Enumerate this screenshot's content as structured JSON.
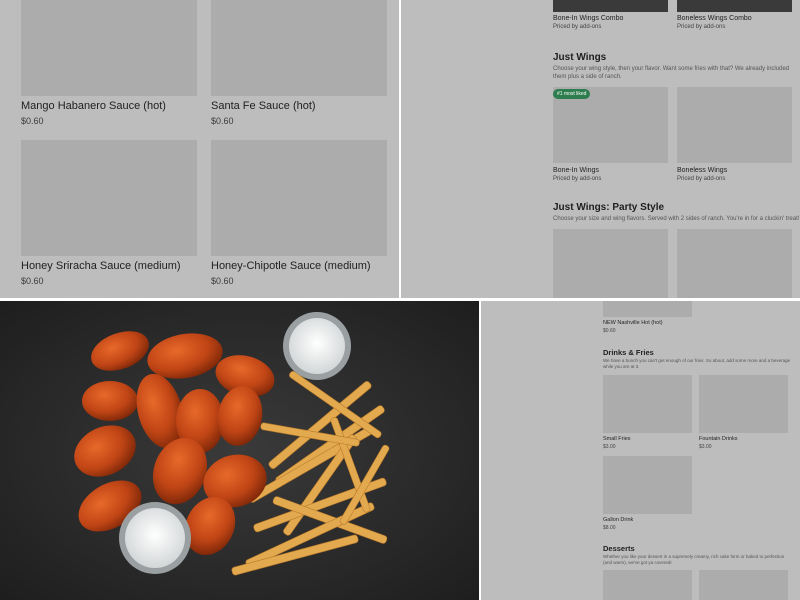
{
  "sauces": [
    {
      "name": "Mango Habanero Sauce (hot)",
      "price": "$0.60"
    },
    {
      "name": "Santa Fe Sauce (hot)",
      "price": "$0.60"
    },
    {
      "name": "Honey Sriracha Sauce (medium)",
      "price": "$0.60"
    },
    {
      "name": "Honey-Chipotle Sauce (medium)",
      "price": "$0.60"
    }
  ],
  "wings_panel": {
    "top_items": [
      {
        "name": "Bone-In Wings Combo",
        "sub": "Priced by add-ons"
      },
      {
        "name": "Boneless Wings Combo",
        "sub": "Priced by add-ons"
      }
    ],
    "just_wings": {
      "title": "Just Wings",
      "description": "Choose your wing style, then your flavor. Want some fries with that? We already included them plus a side of ranch.",
      "badge": "#1 most liked",
      "items": [
        {
          "name": "Bone-In Wings",
          "sub": "Priced by add-ons"
        },
        {
          "name": "Boneless Wings",
          "sub": "Priced by add-ons"
        }
      ]
    },
    "party_style": {
      "title": "Just Wings: Party Style",
      "description": "Choose your size and wing flavors. Served with 2 sides of ranch. You're in for a cluckin' treat!"
    }
  },
  "drinks_panel": {
    "top_item": {
      "name": "NEW Nashville Hot (hot)",
      "price": "$0.60"
    },
    "drinks": {
      "title": "Drinks & Fries",
      "description": "We have a bunch you can't get enough of our fries. So about, add some more and a beverage while you are at it.",
      "items": [
        {
          "name": "Small Fries",
          "price": "$3.00"
        },
        {
          "name": "Fountain Drinks",
          "price": "$3.00"
        },
        {
          "name": "Gallon Drink",
          "price": "$8.00"
        }
      ]
    },
    "desserts": {
      "title": "Desserts",
      "description": "Whether you like your dessert in a supremely creamy, rich cake form or baked to perfection (and warm), we've got ya covered!"
    }
  },
  "colors": {
    "badge": "#2e7d4f",
    "placeholder": "#acacac",
    "panel_bg": "#bdbdbd"
  }
}
